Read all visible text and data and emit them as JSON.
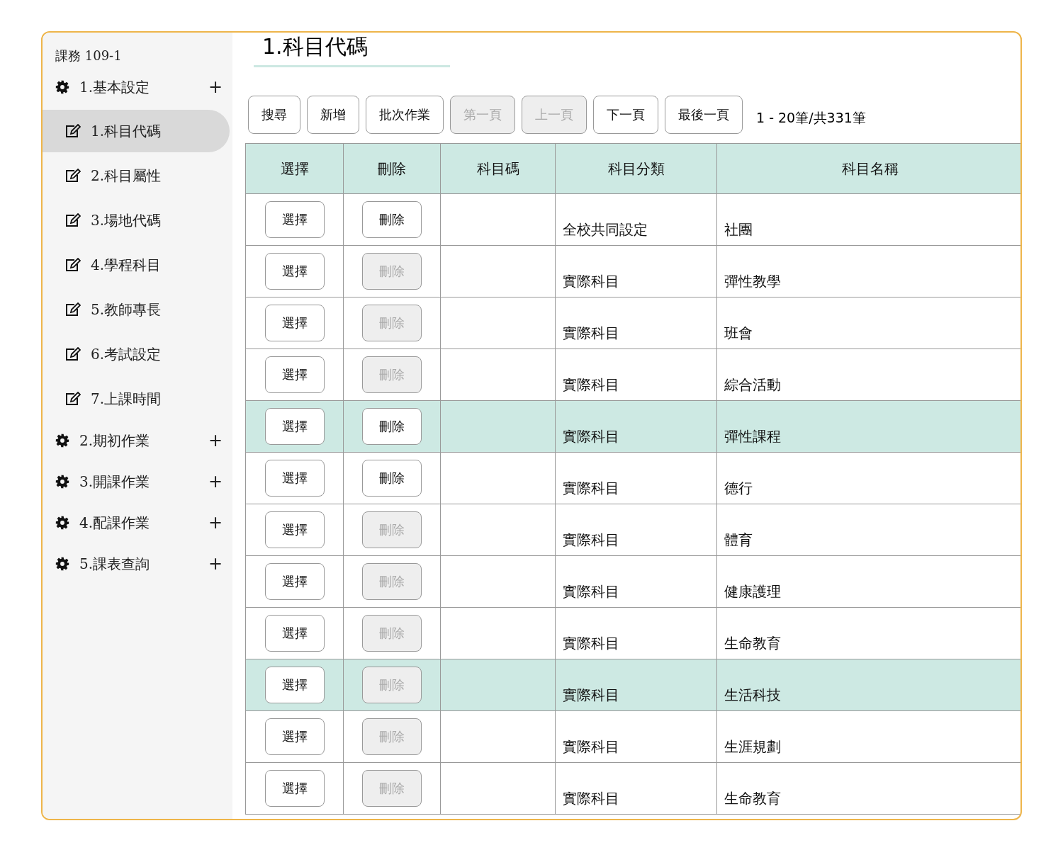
{
  "sidebar": {
    "title": "課務 109-1",
    "groups": [
      {
        "label": "1.基本設定",
        "toggle": "+",
        "children": [
          {
            "label": "1.科目代碼",
            "selected": true
          },
          {
            "label": "2.科目屬性",
            "selected": false
          },
          {
            "label": "3.場地代碼",
            "selected": false
          },
          {
            "label": "4.學程科目",
            "selected": false
          },
          {
            "label": "5.教師專長",
            "selected": false
          },
          {
            "label": "6.考試設定",
            "selected": false
          },
          {
            "label": "7.上課時間",
            "selected": false
          }
        ]
      },
      {
        "label": "2.期初作業",
        "toggle": "+"
      },
      {
        "label": "3.開課作業",
        "toggle": "+"
      },
      {
        "label": "4.配課作業",
        "toggle": "+"
      },
      {
        "label": "5.課表查詢",
        "toggle": "+"
      }
    ]
  },
  "page_title": "1.科目代碼",
  "toolbar": [
    {
      "label": "搜尋",
      "disabled": false
    },
    {
      "label": "新增",
      "disabled": false
    },
    {
      "label": "批次作業",
      "disabled": false
    },
    {
      "label": "第一頁",
      "disabled": true
    },
    {
      "label": "上一頁",
      "disabled": true
    },
    {
      "label": "下一頁",
      "disabled": false
    },
    {
      "label": "最後一頁",
      "disabled": false
    }
  ],
  "page_info": "1 - 20筆/共331筆",
  "table": {
    "columns": [
      "選擇",
      "刪除",
      "科目碼",
      "科目分類",
      "科目名稱"
    ],
    "rows": [
      {
        "select": "選擇",
        "delete": "刪除",
        "delete_disabled": false,
        "category": "全校共同設定",
        "name": "社團",
        "selected": false
      },
      {
        "select": "選擇",
        "delete": "刪除",
        "delete_disabled": true,
        "category": "實際科目",
        "name": "彈性教學",
        "selected": false
      },
      {
        "select": "選擇",
        "delete": "刪除",
        "delete_disabled": true,
        "category": "實際科目",
        "name": "班會",
        "selected": false
      },
      {
        "select": "選擇",
        "delete": "刪除",
        "delete_disabled": true,
        "category": "實際科目",
        "name": "綜合活動",
        "selected": false
      },
      {
        "select": "選擇",
        "delete": "刪除",
        "delete_disabled": false,
        "category": "實際科目",
        "name": "彈性課程",
        "selected": true
      },
      {
        "select": "選擇",
        "delete": "刪除",
        "delete_disabled": false,
        "category": "實際科目",
        "name": "德行",
        "selected": false
      },
      {
        "select": "選擇",
        "delete": "刪除",
        "delete_disabled": true,
        "category": "實際科目",
        "name": "體育",
        "selected": false
      },
      {
        "select": "選擇",
        "delete": "刪除",
        "delete_disabled": true,
        "category": "實際科目",
        "name": "健康護理",
        "selected": false
      },
      {
        "select": "選擇",
        "delete": "刪除",
        "delete_disabled": true,
        "category": "實際科目",
        "name": "生命教育",
        "selected": false
      },
      {
        "select": "選擇",
        "delete": "刪除",
        "delete_disabled": true,
        "category": "實際科目",
        "name": "生活科技",
        "selected": true
      },
      {
        "select": "選擇",
        "delete": "刪除",
        "delete_disabled": true,
        "category": "實際科目",
        "name": "生涯規劃",
        "selected": false
      },
      {
        "select": "選擇",
        "delete": "刪除",
        "delete_disabled": true,
        "category": "實際科目",
        "name": "生命教育",
        "selected": false
      }
    ]
  }
}
